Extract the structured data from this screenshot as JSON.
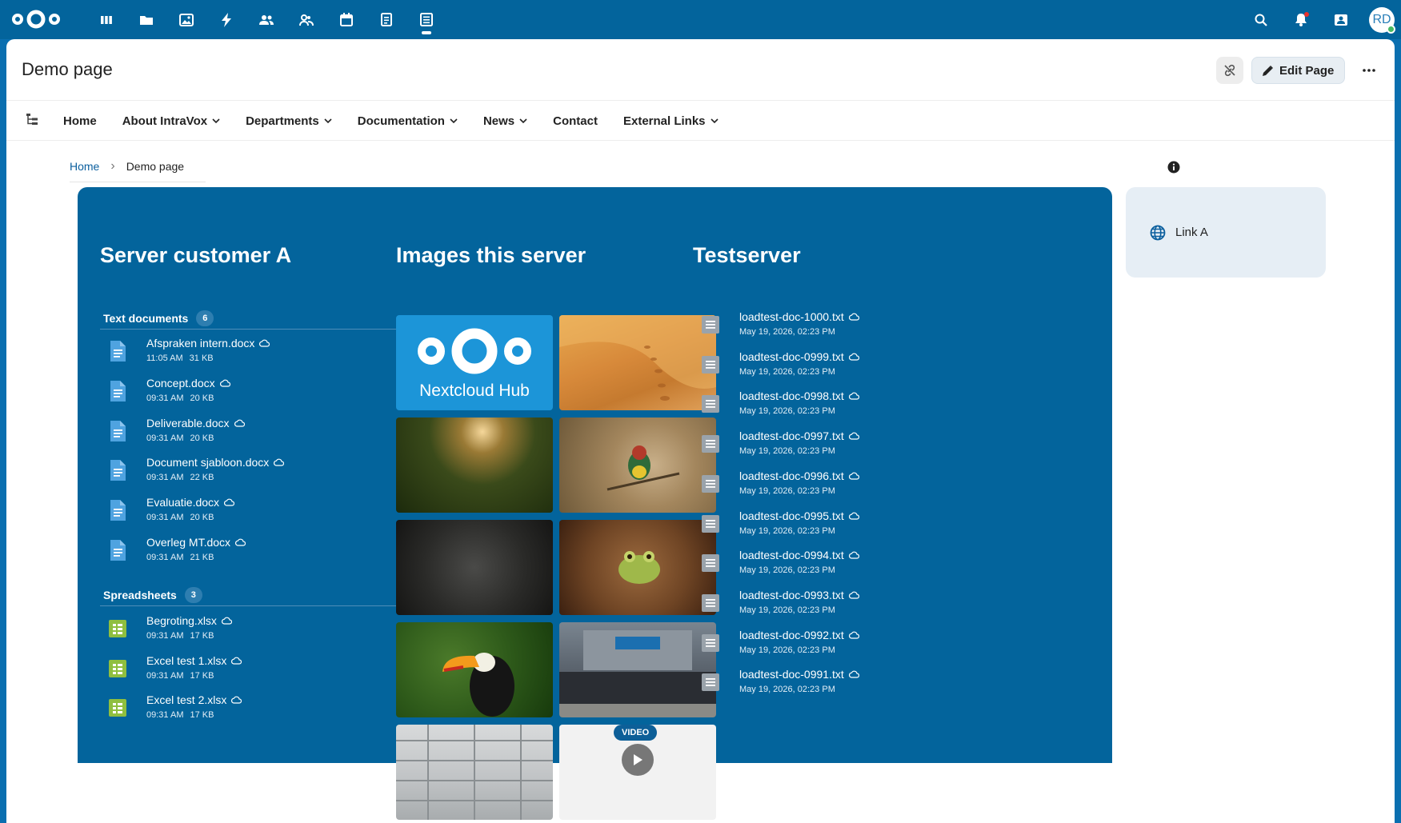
{
  "topbar": {
    "apps": [
      {
        "name": "dashboard-icon"
      },
      {
        "name": "files-icon"
      },
      {
        "name": "photos-icon"
      },
      {
        "name": "activity-icon"
      },
      {
        "name": "contacts-icon"
      },
      {
        "name": "circles-icon"
      },
      {
        "name": "calendar-icon"
      },
      {
        "name": "notes-icon"
      },
      {
        "name": "intravox-icon",
        "active": true
      }
    ],
    "avatar_initials": "RD",
    "accent": "#03649c"
  },
  "page": {
    "title": "Demo page",
    "edit_label": "Edit Page"
  },
  "nav": {
    "items": [
      {
        "label": "Home",
        "dropdown": false
      },
      {
        "label": "About IntraVox",
        "dropdown": true
      },
      {
        "label": "Departments",
        "dropdown": true
      },
      {
        "label": "Documentation",
        "dropdown": true
      },
      {
        "label": "News",
        "dropdown": true
      },
      {
        "label": "Contact",
        "dropdown": false
      },
      {
        "label": "External Links",
        "dropdown": true
      }
    ]
  },
  "breadcrumb": {
    "home": "Home",
    "separator": "›",
    "current": "Demo page"
  },
  "columns": {
    "server_a": {
      "title": "Server customer A",
      "text_docs": {
        "label": "Text documents",
        "count": "6",
        "files": [
          {
            "name": "Afspraken intern.docx",
            "time": "11:05 AM",
            "size": "31 KB"
          },
          {
            "name": "Concept.docx",
            "time": "09:31 AM",
            "size": "20 KB"
          },
          {
            "name": "Deliverable.docx",
            "time": "09:31 AM",
            "size": "20 KB"
          },
          {
            "name": "Document sjabloon.docx",
            "time": "09:31 AM",
            "size": "22 KB"
          },
          {
            "name": "Evaluatie.docx",
            "time": "09:31 AM",
            "size": "20 KB"
          },
          {
            "name": "Overleg MT.docx",
            "time": "09:31 AM",
            "size": "21 KB"
          }
        ]
      },
      "spreadsheets": {
        "label": "Spreadsheets",
        "count": "3",
        "files": [
          {
            "name": "Begroting.xlsx",
            "time": "09:31 AM",
            "size": "17 KB"
          },
          {
            "name": "Excel test 1.xlsx",
            "time": "09:31 AM",
            "size": "17 KB"
          },
          {
            "name": "Excel test 2.xlsx",
            "time": "09:31 AM",
            "size": "17 KB"
          }
        ]
      }
    },
    "images": {
      "title": "Images this server",
      "logo_caption": "Nextcloud Hub",
      "video_badge": "VIDEO"
    },
    "testserver": {
      "title": "Testserver",
      "files": [
        {
          "name": "loadtest-doc-1000.txt",
          "date": "May 19, 2026, 02:23 PM"
        },
        {
          "name": "loadtest-doc-0999.txt",
          "date": "May 19, 2026, 02:23 PM"
        },
        {
          "name": "loadtest-doc-0998.txt",
          "date": "May 19, 2026, 02:23 PM"
        },
        {
          "name": "loadtest-doc-0997.txt",
          "date": "May 19, 2026, 02:23 PM"
        },
        {
          "name": "loadtest-doc-0996.txt",
          "date": "May 19, 2026, 02:23 PM"
        },
        {
          "name": "loadtest-doc-0995.txt",
          "date": "May 19, 2026, 02:23 PM"
        },
        {
          "name": "loadtest-doc-0994.txt",
          "date": "May 19, 2026, 02:23 PM"
        },
        {
          "name": "loadtest-doc-0993.txt",
          "date": "May 19, 2026, 02:23 PM"
        },
        {
          "name": "loadtest-doc-0992.txt",
          "date": "May 19, 2026, 02:23 PM"
        },
        {
          "name": "loadtest-doc-0991.txt",
          "date": "May 19, 2026, 02:23 PM"
        }
      ]
    }
  },
  "side_links": [
    {
      "label": "Link A",
      "icon": "globe-icon"
    }
  ]
}
